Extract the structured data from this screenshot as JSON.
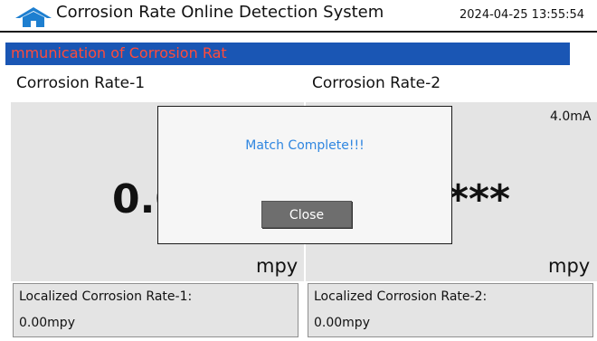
{
  "header": {
    "title": "Corrosion Rate Online Detection System",
    "datetime": "2024-04-25 13:55:54",
    "icon": "home-icon"
  },
  "banner": {
    "text": "mmunication of Corrosion Rat"
  },
  "channels": [
    {
      "label": "Corrosion Rate-1",
      "value": "0.0",
      "unit": "mpy",
      "localized_label": "Localized Corrosion Rate-1:",
      "localized_value": "0.00mpy"
    },
    {
      "label": "Corrosion Rate-2",
      "current": "4.0mA",
      "value": "****",
      "unit": "mpy",
      "localized_label": "Localized Corrosion Rate-2:",
      "localized_value": "0.00mpy"
    }
  ],
  "dialog": {
    "message": "Match Complete!!!",
    "close_label": "Close"
  },
  "colors": {
    "banner_bg": "#1a56b4",
    "banner_text": "#ff4b3a",
    "panel_bg": "#e4e4e4",
    "dialog_text": "#2f86e0",
    "home_icon": "#1e7fd0"
  }
}
